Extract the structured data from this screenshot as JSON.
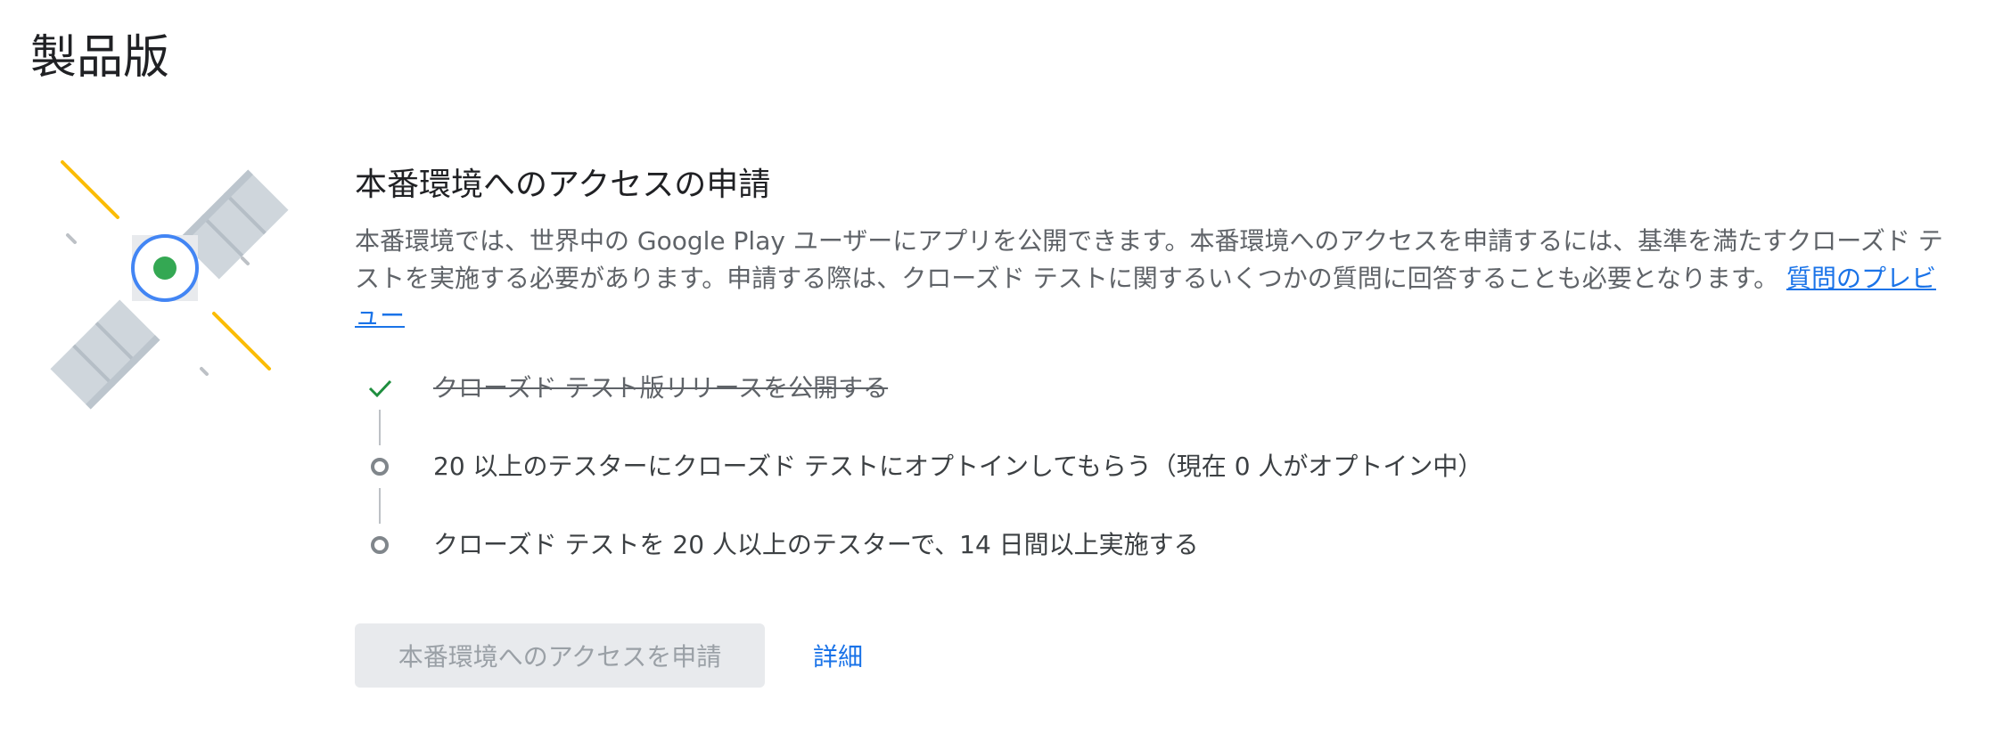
{
  "page": {
    "title": "製品版"
  },
  "section": {
    "title": "本番環境へのアクセスの申請",
    "description": "本番環境では、世界中の Google Play ユーザーにアプリを公開できます。本番環境へのアクセスを申請するには、基準を満たすクローズド テストを実施する必要があります。申請する際は、クローズド テストに関するいくつかの質問に回答することも必要となります。",
    "preview_link": "質問のプレビュー"
  },
  "steps": [
    {
      "label": "クローズド テスト版リリースを公開する",
      "status": "done",
      "icon": "check-icon"
    },
    {
      "label": "20 以上のテスターにクローズド テストにオプトインしてもらう（現在 0 人がオプトイン中）",
      "status": "pending",
      "icon": "circle-icon"
    },
    {
      "label": "クローズド テストを 20 人以上のテスターで、14 日間以上実施する",
      "status": "pending",
      "icon": "circle-icon"
    }
  ],
  "actions": {
    "request_label": "本番環境へのアクセスを申請",
    "details_label": "詳細"
  },
  "colors": {
    "accent": "#1a73e8",
    "check": "#1e8e3e",
    "satellite_core": "#4285f4",
    "satellite_dot": "#34a853",
    "beam": "#fbbc04",
    "panel": "#cfd6dc"
  },
  "illustration": {
    "icon": "satellite-icon"
  }
}
